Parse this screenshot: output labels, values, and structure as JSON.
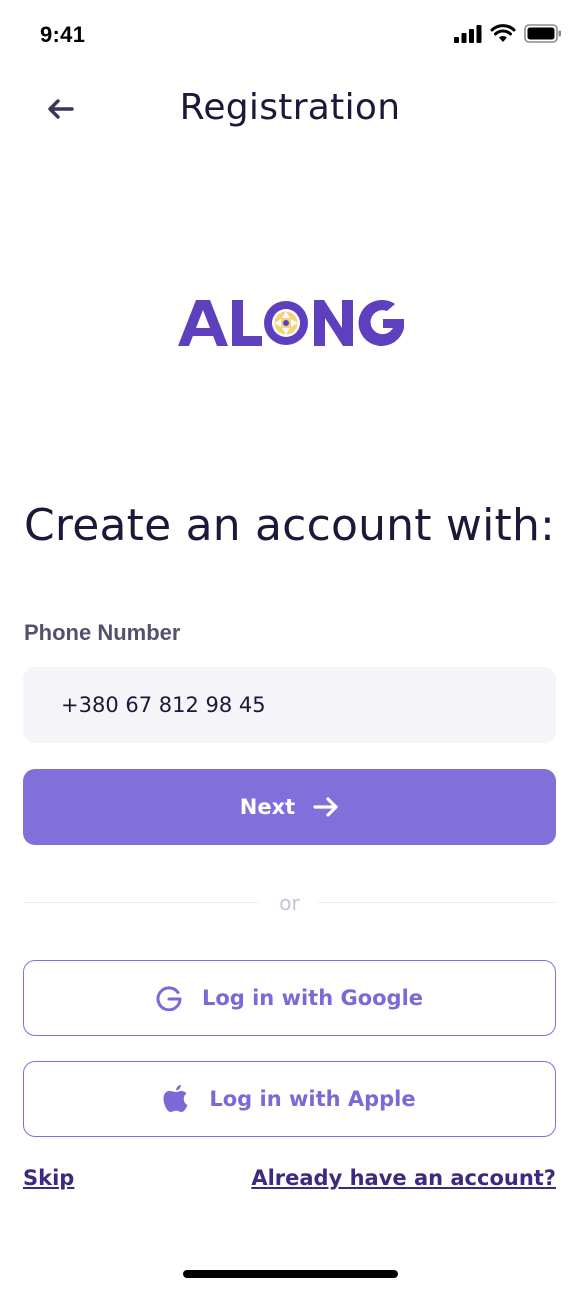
{
  "status_bar": {
    "time": "9:41",
    "icons": [
      "cellular-signal-icon",
      "wifi-icon",
      "battery-icon"
    ]
  },
  "header": {
    "back_icon": "arrow-left-icon",
    "title": "Registration"
  },
  "logo": {
    "text": "ALONG",
    "brand_color": "#5e3fbe",
    "accent_color": "#f6d27a"
  },
  "main": {
    "heading": "Create an account with:",
    "phone_field": {
      "label": "Phone Number",
      "value": "+380 67 812 98 45",
      "placeholder": ""
    },
    "next_button": {
      "label": "Next",
      "icon": "arrow-right-icon"
    },
    "divider_text": "or",
    "social_buttons": [
      {
        "label": "Log in with Google",
        "icon": "google-icon"
      },
      {
        "label": "Log in with Apple",
        "icon": "apple-icon"
      }
    ],
    "footer": {
      "skip_label": "Skip",
      "have_account_label": "Already have an account?"
    }
  },
  "colors": {
    "primary": "#8170d9",
    "text_dark": "#1c1838",
    "input_bg": "#f4f4f9",
    "link": "#3d2a80"
  }
}
